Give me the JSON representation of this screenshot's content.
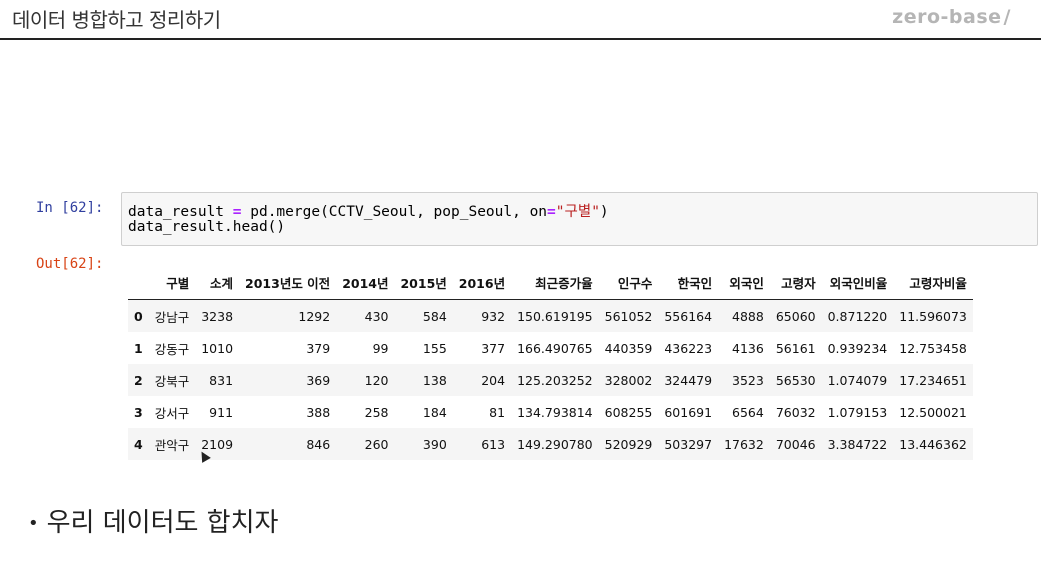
{
  "header": {
    "title": "데이터 병합하고 정리하기",
    "brand": "zero-base",
    "brand_mark": "/"
  },
  "cell": {
    "in_prompt": "In [62]:",
    "out_prompt": "Out[62]:",
    "code_line1_parts": [
      "data_result ",
      "=",
      " pd.merge(CCTV_Seoul, pop_Seoul, on",
      "=",
      "\"구별\"",
      ")"
    ],
    "code_line2": "data_result.head()"
  },
  "table": {
    "columns": [
      "",
      "구별",
      "소계",
      "2013년도 이전",
      "2014년",
      "2015년",
      "2016년",
      "최근증가율",
      "인구수",
      "한국인",
      "외국인",
      "고령자",
      "외국인비율",
      "고령자비율"
    ],
    "rows": [
      [
        "0",
        "강남구",
        "3238",
        "1292",
        "430",
        "584",
        "932",
        "150.619195",
        "561052",
        "556164",
        "4888",
        "65060",
        "0.871220",
        "11.596073"
      ],
      [
        "1",
        "강동구",
        "1010",
        "379",
        "99",
        "155",
        "377",
        "166.490765",
        "440359",
        "436223",
        "4136",
        "56161",
        "0.939234",
        "12.753458"
      ],
      [
        "2",
        "강북구",
        "831",
        "369",
        "120",
        "138",
        "204",
        "125.203252",
        "328002",
        "324479",
        "3523",
        "56530",
        "1.074079",
        "17.234651"
      ],
      [
        "3",
        "강서구",
        "911",
        "388",
        "258",
        "184",
        "81",
        "134.793814",
        "608255",
        "601691",
        "6564",
        "76032",
        "1.079153",
        "12.500021"
      ],
      [
        "4",
        "관악구",
        "2109",
        "846",
        "260",
        "390",
        "613",
        "149.290780",
        "520929",
        "503297",
        "17632",
        "70046",
        "3.384722",
        "13.446362"
      ]
    ]
  },
  "bullet": {
    "symbol": "•",
    "text": "우리 데이터도 합치자"
  }
}
